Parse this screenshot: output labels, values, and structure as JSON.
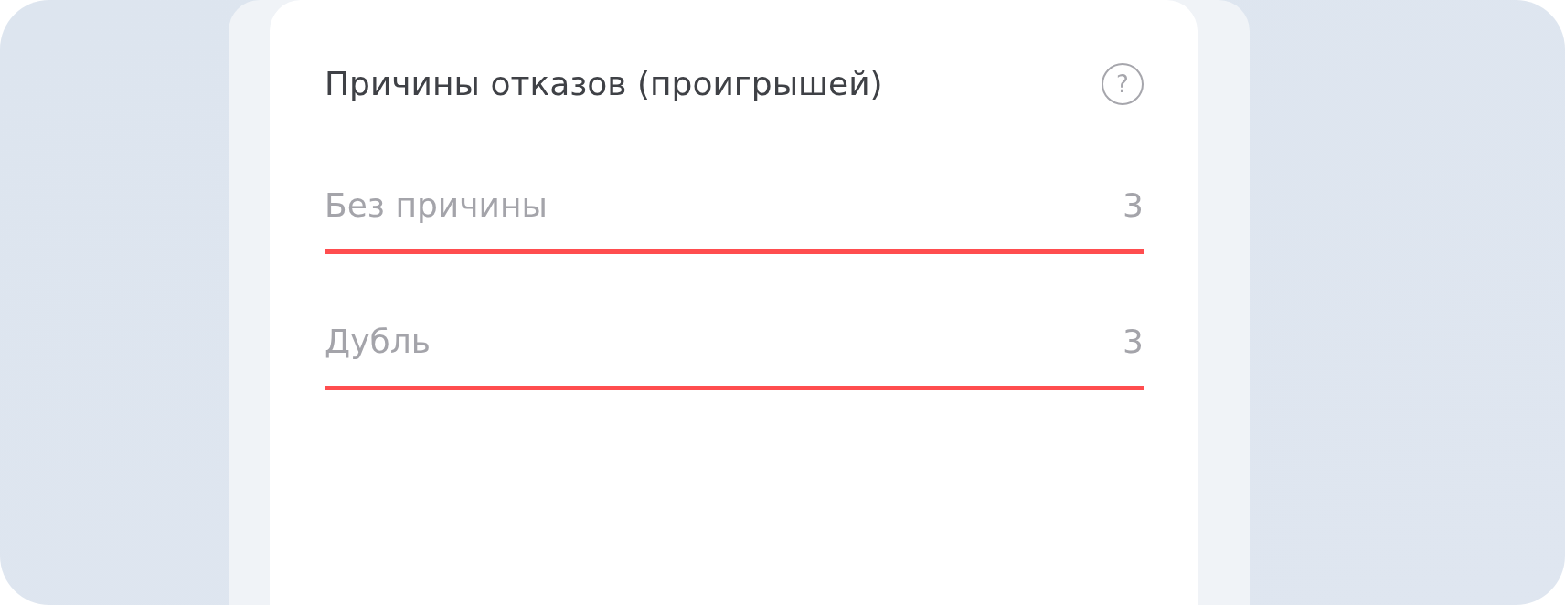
{
  "card": {
    "title": "Причины отказов (проигрышей)",
    "help_icon": "?"
  },
  "reasons": [
    {
      "label": "Без причины",
      "count": "3",
      "color": "#ff4d4f"
    },
    {
      "label": "Дубль",
      "count": "3",
      "color": "#ff4d4f"
    }
  ]
}
